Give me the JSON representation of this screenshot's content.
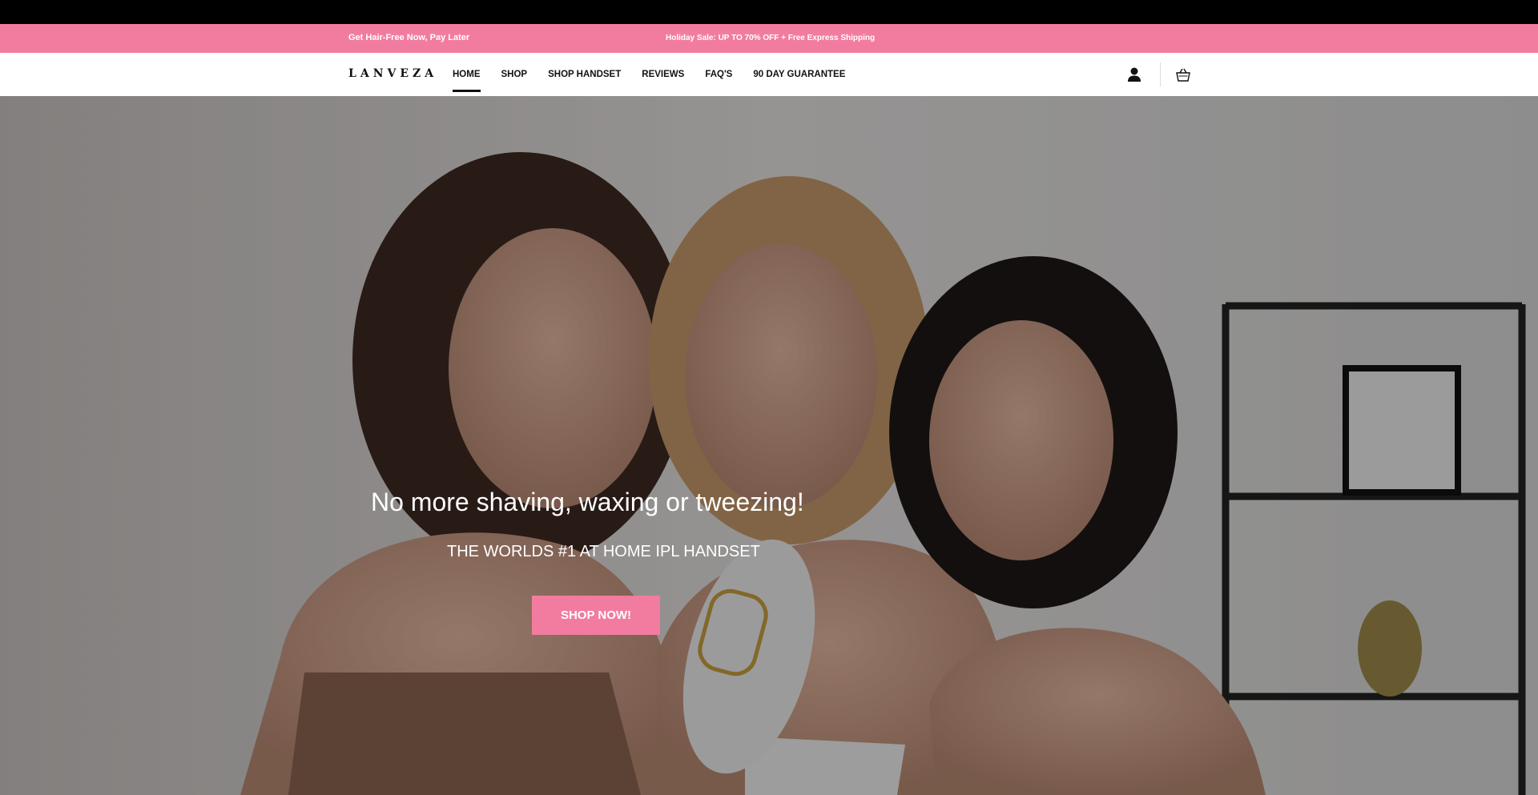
{
  "announcement": {
    "left_text": "Get Hair-Free Now, Pay Later",
    "center_text": "Holiday Sale: UP TO 70% OFF + Free Express Shipping"
  },
  "header": {
    "logo": "LANVEZA",
    "nav": [
      {
        "label": "HOME"
      },
      {
        "label": "SHOP"
      },
      {
        "label": "SHOP HANDSET"
      },
      {
        "label": "REVIEWS"
      },
      {
        "label": "FAQ'S"
      },
      {
        "label": "90 DAY GUARANTEE"
      }
    ],
    "account_icon": "user-icon",
    "cart_icon": "shopping-bag-icon"
  },
  "hero": {
    "title": "No more shaving, waxing or tweezing!",
    "subtitle": "THE WORLDS #1 AT HOME IPL HANDSET",
    "cta": "SHOP NOW!"
  },
  "colors": {
    "accent": "#f27ca0",
    "text": "#111111"
  }
}
